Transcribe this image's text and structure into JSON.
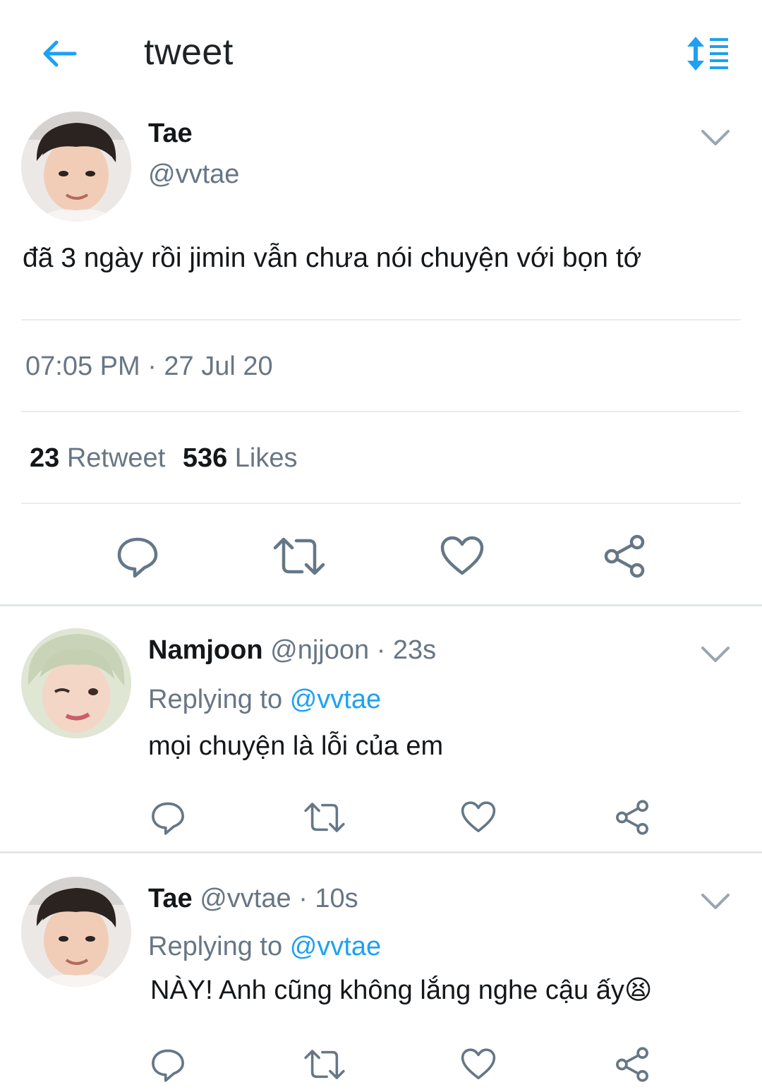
{
  "header": {
    "title": "tweet"
  },
  "colors": {
    "accent": "#1da1f2",
    "muted": "#687684",
    "text": "#14171a",
    "divider": "#e6ecf0"
  },
  "main_tweet": {
    "name": "Tae",
    "handle": "@vvtae",
    "text": "đã 3 ngày rồi jimin vẫn chưa nói chuyện với bọn tớ",
    "timestamp": "07:05 PM · 27 Jul 20",
    "retweet_count": "23",
    "retweet_label": "Retweet",
    "like_count": "536",
    "like_label": "Likes"
  },
  "replies": [
    {
      "name": "Namjoon",
      "handle": "@njjoon",
      "time": "· 23s",
      "replying_label": "Replying to",
      "replying_to": "@vvtae",
      "text": "mọi chuyện là lỗi của em"
    },
    {
      "name": "Tae",
      "handle": "@vvtae",
      "time": "· 10s",
      "replying_label": "Replying to",
      "replying_to": "@vvtae",
      "text": "NÀY! Anh cũng không lắng nghe cậu ấy😫"
    }
  ],
  "icons": [
    "back-arrow-icon",
    "sort-icon",
    "chevron-down-icon",
    "reply-icon",
    "retweet-icon",
    "like-icon",
    "share-icon"
  ]
}
